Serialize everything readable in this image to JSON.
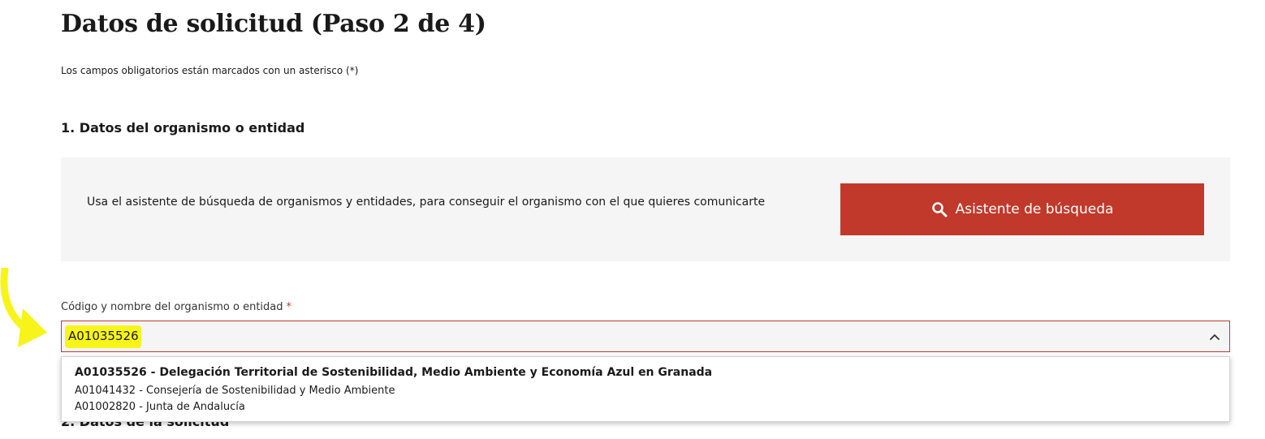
{
  "page": {
    "title": "Datos de solicitud (Paso 2 de 4)",
    "required_note": "Los campos obligatorios están marcados con un asterisco (*)"
  },
  "section1": {
    "title": "1. Datos del organismo o entidad",
    "search_panel": {
      "text": "Usa el asistente de búsqueda de organismos y entidades, para conseguir el organismo con el que quieres comunicarte",
      "button_label": "Asistente de búsqueda",
      "button_icon": "search-icon",
      "button_color": "#c0392b"
    },
    "field": {
      "label": "Código y nombre del organismo o entidad",
      "required_mark": "*",
      "value": "A01035526",
      "expanded_icon": "chevron-up-icon"
    },
    "dropdown": {
      "options": [
        "A01035526 - Delegación Territorial de Sostenibilidad, Medio Ambiente y Economía Azul en Granada",
        "A01041432 - Consejería de Sostenibilidad y Medio Ambiente",
        "A01002820 - Junta de Andalucía"
      ]
    }
  },
  "section2": {
    "title": "2. Datos de la solicitud"
  },
  "annotation": {
    "highlight_color": "#f7f41a",
    "arrow_icon": "yellow-arrow-icon"
  }
}
